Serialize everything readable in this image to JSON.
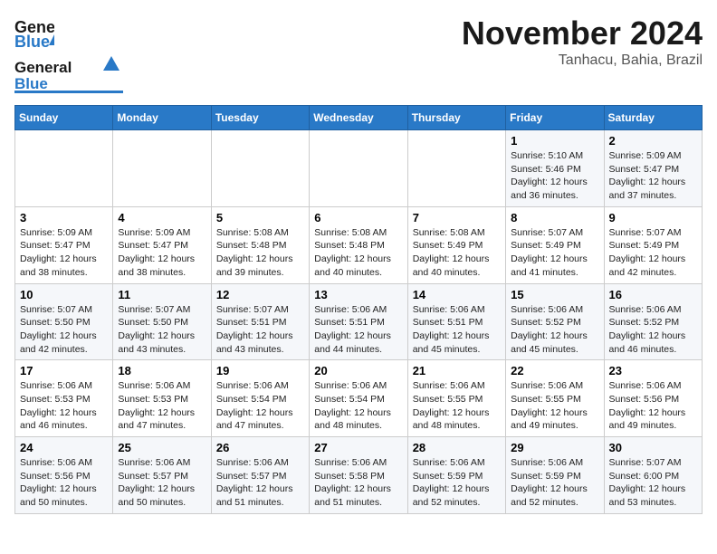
{
  "header": {
    "logo_general": "General",
    "logo_blue": "Blue",
    "month": "November 2024",
    "location": "Tanhacu, Bahia, Brazil"
  },
  "days_of_week": [
    "Sunday",
    "Monday",
    "Tuesday",
    "Wednesday",
    "Thursday",
    "Friday",
    "Saturday"
  ],
  "weeks": [
    [
      {
        "day": "",
        "info": ""
      },
      {
        "day": "",
        "info": ""
      },
      {
        "day": "",
        "info": ""
      },
      {
        "day": "",
        "info": ""
      },
      {
        "day": "",
        "info": ""
      },
      {
        "day": "1",
        "info": "Sunrise: 5:10 AM\nSunset: 5:46 PM\nDaylight: 12 hours and 36 minutes."
      },
      {
        "day": "2",
        "info": "Sunrise: 5:09 AM\nSunset: 5:47 PM\nDaylight: 12 hours and 37 minutes."
      }
    ],
    [
      {
        "day": "3",
        "info": "Sunrise: 5:09 AM\nSunset: 5:47 PM\nDaylight: 12 hours and 38 minutes."
      },
      {
        "day": "4",
        "info": "Sunrise: 5:09 AM\nSunset: 5:47 PM\nDaylight: 12 hours and 38 minutes."
      },
      {
        "day": "5",
        "info": "Sunrise: 5:08 AM\nSunset: 5:48 PM\nDaylight: 12 hours and 39 minutes."
      },
      {
        "day": "6",
        "info": "Sunrise: 5:08 AM\nSunset: 5:48 PM\nDaylight: 12 hours and 40 minutes."
      },
      {
        "day": "7",
        "info": "Sunrise: 5:08 AM\nSunset: 5:49 PM\nDaylight: 12 hours and 40 minutes."
      },
      {
        "day": "8",
        "info": "Sunrise: 5:07 AM\nSunset: 5:49 PM\nDaylight: 12 hours and 41 minutes."
      },
      {
        "day": "9",
        "info": "Sunrise: 5:07 AM\nSunset: 5:49 PM\nDaylight: 12 hours and 42 minutes."
      }
    ],
    [
      {
        "day": "10",
        "info": "Sunrise: 5:07 AM\nSunset: 5:50 PM\nDaylight: 12 hours and 42 minutes."
      },
      {
        "day": "11",
        "info": "Sunrise: 5:07 AM\nSunset: 5:50 PM\nDaylight: 12 hours and 43 minutes."
      },
      {
        "day": "12",
        "info": "Sunrise: 5:07 AM\nSunset: 5:51 PM\nDaylight: 12 hours and 43 minutes."
      },
      {
        "day": "13",
        "info": "Sunrise: 5:06 AM\nSunset: 5:51 PM\nDaylight: 12 hours and 44 minutes."
      },
      {
        "day": "14",
        "info": "Sunrise: 5:06 AM\nSunset: 5:51 PM\nDaylight: 12 hours and 45 minutes."
      },
      {
        "day": "15",
        "info": "Sunrise: 5:06 AM\nSunset: 5:52 PM\nDaylight: 12 hours and 45 minutes."
      },
      {
        "day": "16",
        "info": "Sunrise: 5:06 AM\nSunset: 5:52 PM\nDaylight: 12 hours and 46 minutes."
      }
    ],
    [
      {
        "day": "17",
        "info": "Sunrise: 5:06 AM\nSunset: 5:53 PM\nDaylight: 12 hours and 46 minutes."
      },
      {
        "day": "18",
        "info": "Sunrise: 5:06 AM\nSunset: 5:53 PM\nDaylight: 12 hours and 47 minutes."
      },
      {
        "day": "19",
        "info": "Sunrise: 5:06 AM\nSunset: 5:54 PM\nDaylight: 12 hours and 47 minutes."
      },
      {
        "day": "20",
        "info": "Sunrise: 5:06 AM\nSunset: 5:54 PM\nDaylight: 12 hours and 48 minutes."
      },
      {
        "day": "21",
        "info": "Sunrise: 5:06 AM\nSunset: 5:55 PM\nDaylight: 12 hours and 48 minutes."
      },
      {
        "day": "22",
        "info": "Sunrise: 5:06 AM\nSunset: 5:55 PM\nDaylight: 12 hours and 49 minutes."
      },
      {
        "day": "23",
        "info": "Sunrise: 5:06 AM\nSunset: 5:56 PM\nDaylight: 12 hours and 49 minutes."
      }
    ],
    [
      {
        "day": "24",
        "info": "Sunrise: 5:06 AM\nSunset: 5:56 PM\nDaylight: 12 hours and 50 minutes."
      },
      {
        "day": "25",
        "info": "Sunrise: 5:06 AM\nSunset: 5:57 PM\nDaylight: 12 hours and 50 minutes."
      },
      {
        "day": "26",
        "info": "Sunrise: 5:06 AM\nSunset: 5:57 PM\nDaylight: 12 hours and 51 minutes."
      },
      {
        "day": "27",
        "info": "Sunrise: 5:06 AM\nSunset: 5:58 PM\nDaylight: 12 hours and 51 minutes."
      },
      {
        "day": "28",
        "info": "Sunrise: 5:06 AM\nSunset: 5:59 PM\nDaylight: 12 hours and 52 minutes."
      },
      {
        "day": "29",
        "info": "Sunrise: 5:06 AM\nSunset: 5:59 PM\nDaylight: 12 hours and 52 minutes."
      },
      {
        "day": "30",
        "info": "Sunrise: 5:07 AM\nSunset: 6:00 PM\nDaylight: 12 hours and 53 minutes."
      }
    ]
  ]
}
